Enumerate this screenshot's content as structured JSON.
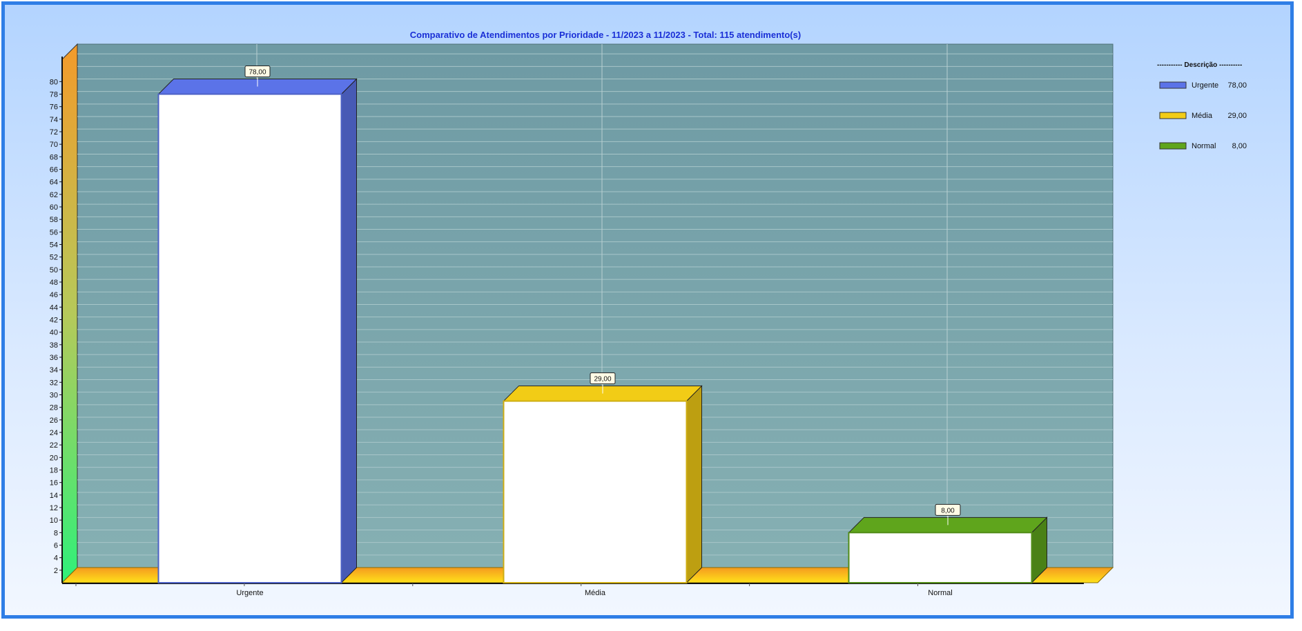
{
  "chart_data": {
    "type": "bar",
    "title": "Comparativo de Atendimentos por Prioridade - 11/2023 a 11/2023 - Total: 115 atendimento(s)",
    "categories": [
      "Urgente",
      "Média",
      "Normal"
    ],
    "values": [
      78,
      29,
      8
    ],
    "value_labels": [
      "78,00",
      "29,00",
      "8,00"
    ],
    "ylim": [
      0,
      84
    ],
    "y_tick_step": 2,
    "y_tick_labels": [
      "2",
      "4",
      "6",
      "8",
      "10",
      "12",
      "14",
      "16",
      "18",
      "20",
      "22",
      "24",
      "26",
      "28",
      "30",
      "32",
      "34",
      "36",
      "38",
      "40",
      "42",
      "44",
      "46",
      "48",
      "50",
      "52",
      "54",
      "56",
      "58",
      "60",
      "62",
      "64",
      "66",
      "68",
      "70",
      "72",
      "74",
      "76",
      "78",
      "80"
    ],
    "grid": true,
    "style": "3d",
    "colors": [
      "#5b73e8",
      "#f2cc16",
      "#5fa51c"
    ],
    "legend": {
      "placement": "right",
      "title": "----------- Descrição ----------",
      "entries": [
        {
          "label": "Urgente",
          "value": "78,00",
          "color": "#5b73e8"
        },
        {
          "label": "Média",
          "value": "29,00",
          "color": "#f2cc16"
        },
        {
          "label": "Normal",
          "value": "8,00",
          "color": "#5fa51c"
        }
      ]
    },
    "plot_background": "#7fa9ae",
    "frame_color": "#2f7ee6"
  }
}
